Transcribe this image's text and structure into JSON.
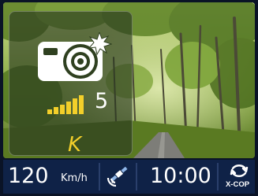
{
  "alert": {
    "icon": "speed-camera-icon",
    "signal_icon": "signal-strength-icon",
    "signal_level": "5",
    "band": "K",
    "colors": {
      "band": "#f3cf2a",
      "bars": "#f3cf2a",
      "icon": "#ffffff"
    }
  },
  "status_bar": {
    "speed_value": "120",
    "speed_unit": "Km/h",
    "gps_icon": "gps-satellite-icon",
    "clock": "10:00",
    "brand_icon": "x-cop-logo-icon",
    "brand_label": "X-COP",
    "colors": {
      "background": "#0f2247",
      "text": "#ffffff"
    }
  }
}
